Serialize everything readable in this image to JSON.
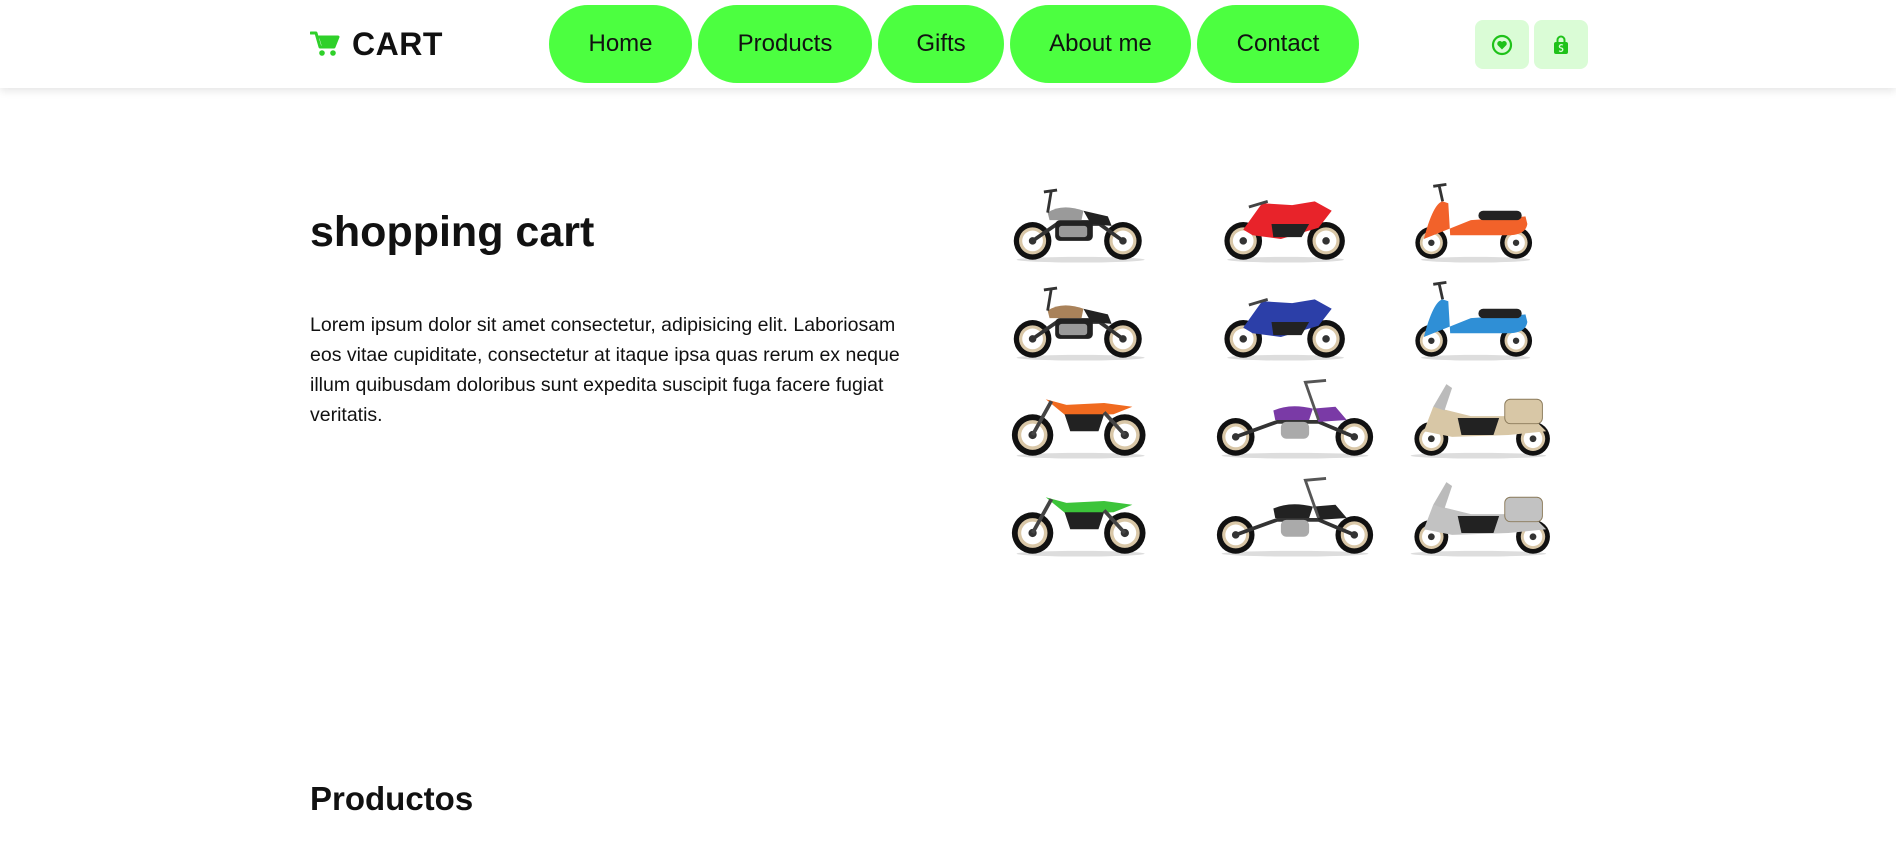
{
  "brand": {
    "name": "CART",
    "icon": "cart-icon",
    "accent": "#4cff40"
  },
  "nav": {
    "items": [
      {
        "label": "Home"
      },
      {
        "label": "Products"
      },
      {
        "label": "Gifts"
      },
      {
        "label": "About me"
      },
      {
        "label": "Contact"
      }
    ]
  },
  "actions": {
    "icons": [
      "heart-icon",
      "shopping-bag-icon"
    ],
    "bg": "#dafcd6"
  },
  "hero": {
    "title": "shopping cart",
    "text": "Lorem ipsum dolor sit amet consectetur, adipisicing elit. Laboriosam eos vitae cupiditate, consectetur at itaque ipsa quas rerum ex neque illum quibusdam doloribus sunt expedita suscipit fuga facere fugiat veritatis.",
    "motorcycles": [
      {
        "kind": "cruiser",
        "color": "#9a9a9a"
      },
      {
        "kind": "sport",
        "color": "#e8232a"
      },
      {
        "kind": "scooter",
        "color": "#f2622a"
      },
      {
        "kind": "cruiser",
        "color": "#a9825a"
      },
      {
        "kind": "sport",
        "color": "#2c3fa8"
      },
      {
        "kind": "scooter",
        "color": "#2f8fd6"
      },
      {
        "kind": "dirt",
        "color": "#f06a1f"
      },
      {
        "kind": "chopper",
        "color": "#7a3aa6"
      },
      {
        "kind": "touring",
        "color": "#d8c7a6"
      },
      {
        "kind": "dirt",
        "color": "#3cc43a"
      },
      {
        "kind": "chopper",
        "color": "#222222"
      },
      {
        "kind": "touring",
        "color": "#c2c2c2"
      }
    ]
  },
  "section": {
    "title": "Productos"
  }
}
